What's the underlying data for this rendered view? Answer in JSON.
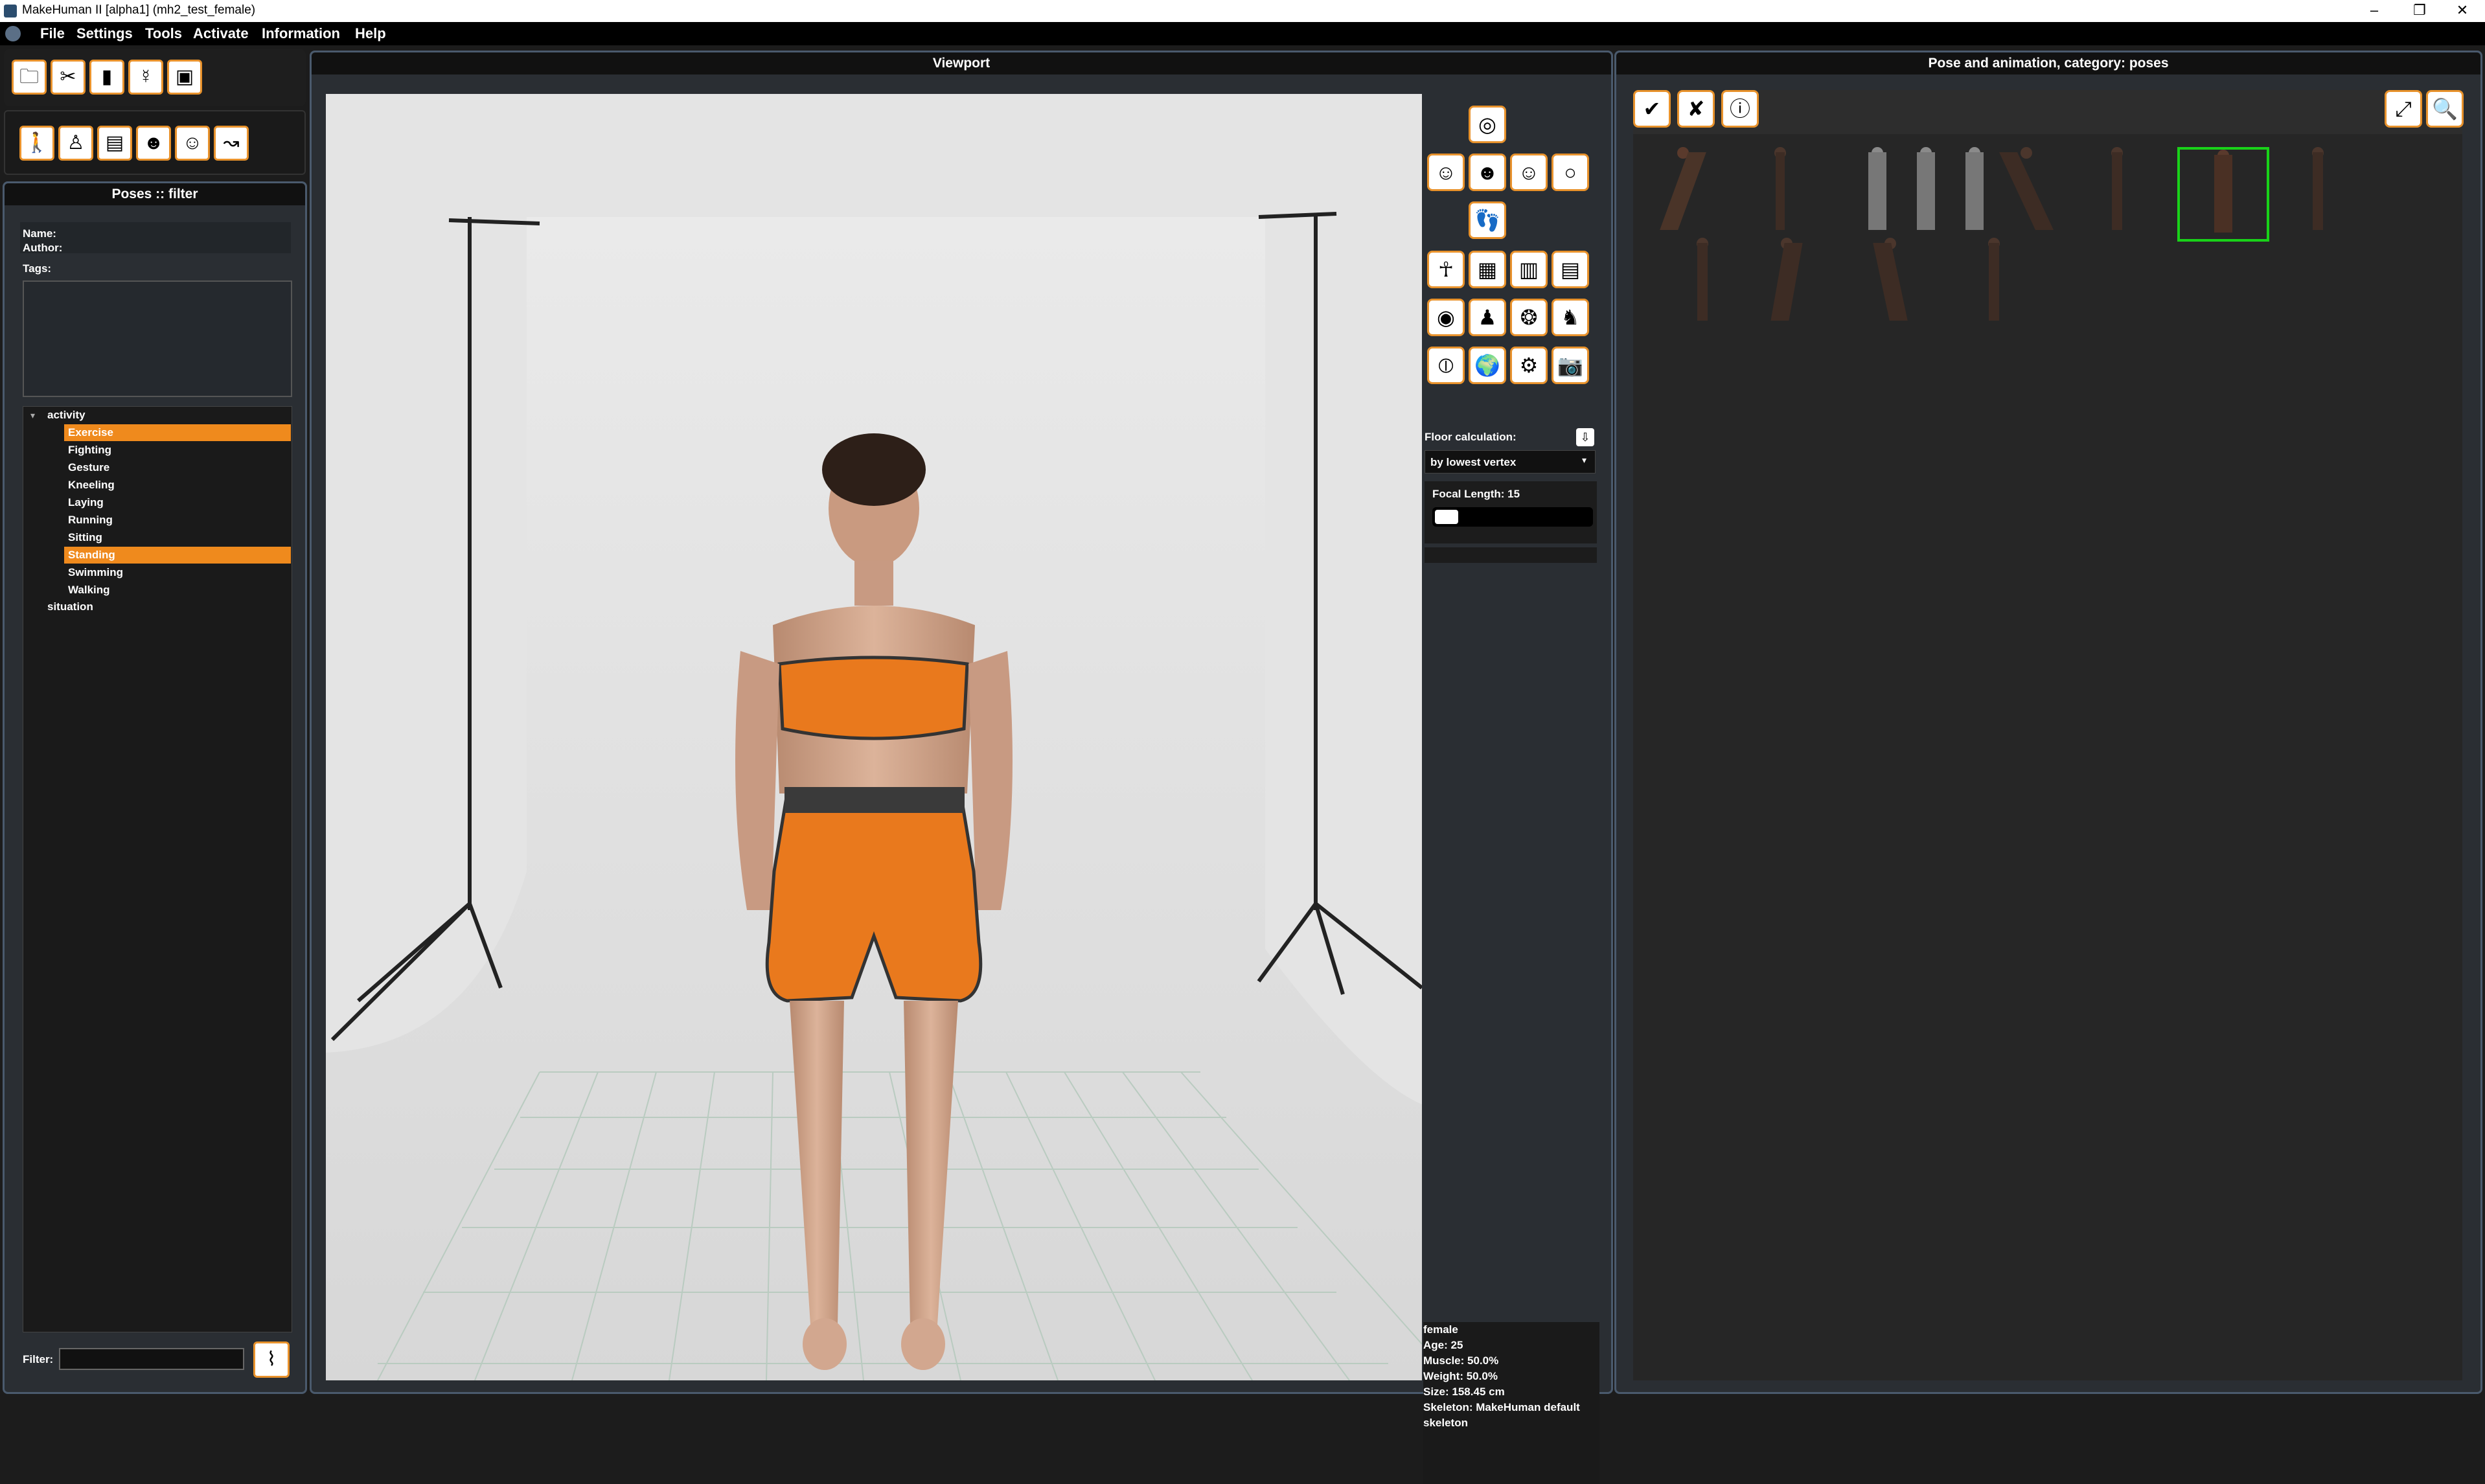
{
  "window": {
    "title": "MakeHuman II [alpha1]  (mh2_test_female)"
  },
  "menu": [
    "File",
    "Settings",
    "Tools",
    "Activate",
    "Information",
    "Help"
  ],
  "left_panel": {
    "header": "Poses :: filter",
    "name_label": "Name:",
    "author_label": "Author:",
    "tags_label": "Tags:",
    "tree": {
      "root1": "activity",
      "items": [
        "Exercise",
        "Fighting",
        "Gesture",
        "Kneeling",
        "Laying",
        "Running",
        "Sitting",
        "Standing",
        "Swimming",
        "Walking"
      ],
      "selected": [
        "Exercise",
        "Standing"
      ],
      "root2": "situation"
    },
    "filter_label": "Filter:",
    "filter_value": ""
  },
  "viewport": {
    "header": "Viewport",
    "floor_label": "Floor calculation:",
    "floor_value": "by lowest vertex",
    "focal_label": "Focal Length: 15",
    "info": {
      "gender": "female",
      "age": "Age: 25",
      "muscle": "Muscle: 50.0%",
      "weight": "Weight: 50.0%",
      "size": "Size: 158.45 cm",
      "skeleton": "Skeleton: MakeHuman default skeleton"
    }
  },
  "right_panel": {
    "header": "Pose and animation, category: poses",
    "selected_thumbnail_index": 6
  },
  "colors": {
    "accent": "#ef8a1d",
    "panel_border": "#4a5a6d",
    "selection_green": "#19d219"
  }
}
